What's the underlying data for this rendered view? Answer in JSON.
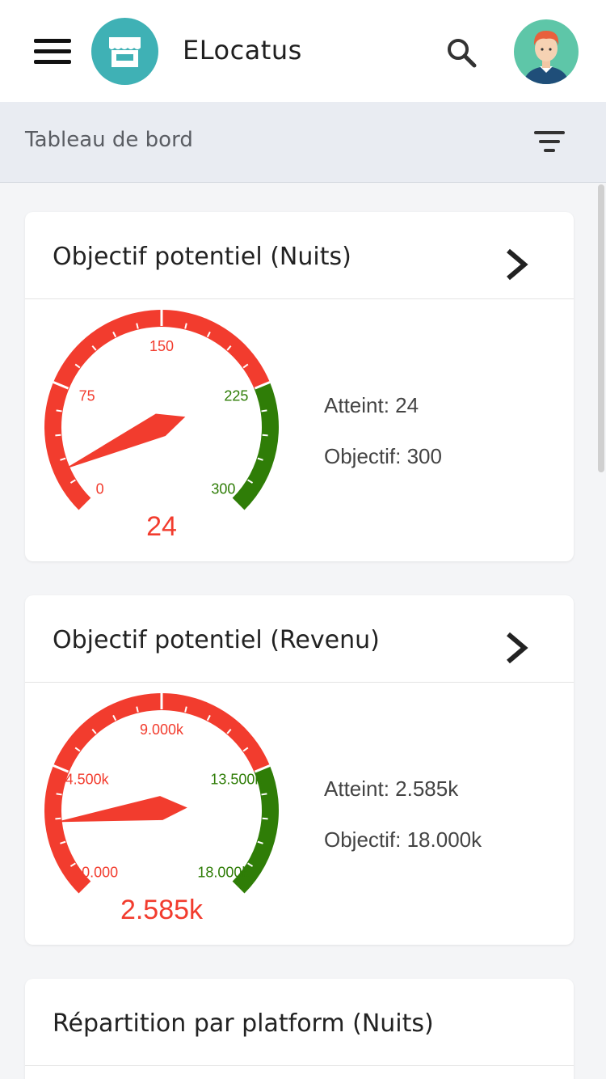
{
  "app": {
    "title": "ELocatus"
  },
  "subheader": {
    "title": "Tableau de bord"
  },
  "gauges": [
    {
      "title": "Objectif potentiel (Nuits)",
      "ticks": [
        "0",
        "75",
        "150",
        "225",
        "300"
      ],
      "value_label": "24",
      "value": 24,
      "max": 300,
      "green_from": 0.75,
      "atteint": "Atteint: 24",
      "objectif": "Objectif: 300"
    },
    {
      "title": "Objectif potentiel (Revenu)",
      "ticks": [
        "0.000",
        "4.500k",
        "9.000k",
        "13.500k",
        "18.000k"
      ],
      "value_label": "2.585k",
      "value": 2585,
      "max": 18000,
      "green_from": 0.75,
      "atteint": "Atteint: 2.585k",
      "objectif": "Objectif: 18.000k"
    }
  ],
  "section3": {
    "title": "Répartition par platform (Nuits)"
  },
  "colors": {
    "red": "#f23c2e",
    "green": "#2f7d07",
    "teal": "#3fb1b5",
    "avatar_bg": "#5ec6a8"
  },
  "icons": {
    "menu": "menu-icon",
    "logo": "store-icon",
    "search": "search-icon",
    "avatar": "avatar",
    "filter": "filter-icon",
    "chevron": "chevron-right-icon"
  }
}
